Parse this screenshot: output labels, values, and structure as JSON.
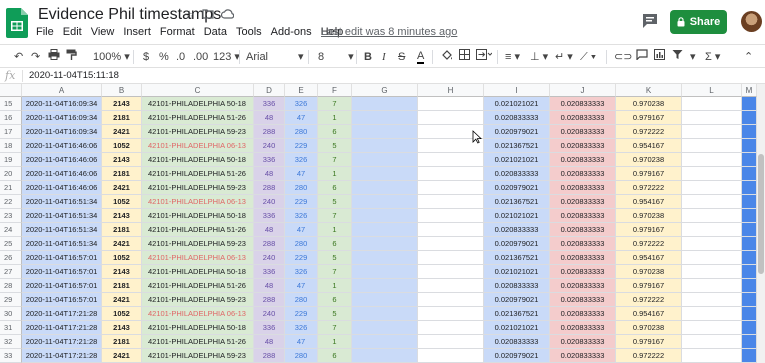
{
  "app": {
    "title": "Evidence Phil timestamps",
    "last_edit": "Last edit was 8 minutes ago",
    "share_label": "Share",
    "colors": {
      "share": "#1e8e3e",
      "sheets_green": "#0f9d58"
    }
  },
  "menu": [
    "File",
    "Edit",
    "View",
    "Insert",
    "Format",
    "Data",
    "Tools",
    "Add-ons",
    "Help"
  ],
  "toolbar": {
    "zoom": "100%",
    "currency": "$",
    "percent": "%",
    "decimal_decrease": ".0",
    "decimal_increase": ".00",
    "more_formats": "123",
    "font": "Arial",
    "font_size": "8",
    "bold": "B",
    "italic": "I",
    "strike": "S",
    "text_color": "A",
    "sigma": "Σ"
  },
  "formula_bar": {
    "fx": "fx",
    "value": "2020-11-04T15:11:18"
  },
  "columns": [
    "A",
    "B",
    "C",
    "D",
    "E",
    "F",
    "G",
    "H",
    "I",
    "J",
    "K",
    "L",
    "M"
  ],
  "rows": [
    {
      "n": "15",
      "a": "2020-11-04T16:09:34",
      "b": "2143",
      "c": "42101-PHILADELPHIA 50-18",
      "red": false,
      "d": "336",
      "e": "326",
      "f": "7",
      "i": "0.021021021",
      "j": "0.020833333",
      "k": "0.970238"
    },
    {
      "n": "16",
      "a": "2020-11-04T16:09:34",
      "b": "2181",
      "c": "42101-PHILADELPHIA 51-26",
      "red": false,
      "d": "48",
      "e": "47",
      "f": "1",
      "i": "0.020833333",
      "j": "0.020833333",
      "k": "0.979167"
    },
    {
      "n": "17",
      "a": "2020-11-04T16:09:34",
      "b": "2421",
      "c": "42101-PHILADELPHIA 59-23",
      "red": false,
      "d": "288",
      "e": "280",
      "f": "6",
      "i": "0.020979021",
      "j": "0.020833333",
      "k": "0.972222"
    },
    {
      "n": "18",
      "a": "2020-11-04T16:46:06",
      "b": "1052",
      "c": "42101-PHILADELPHIA 06-13",
      "red": true,
      "d": "240",
      "e": "229",
      "f": "5",
      "i": "0.021367521",
      "j": "0.020833333",
      "k": "0.954167"
    },
    {
      "n": "19",
      "a": "2020-11-04T16:46:06",
      "b": "2143",
      "c": "42101-PHILADELPHIA 50-18",
      "red": false,
      "d": "336",
      "e": "326",
      "f": "7",
      "i": "0.021021021",
      "j": "0.020833333",
      "k": "0.970238"
    },
    {
      "n": "20",
      "a": "2020-11-04T16:46:06",
      "b": "2181",
      "c": "42101-PHILADELPHIA 51-26",
      "red": false,
      "d": "48",
      "e": "47",
      "f": "1",
      "i": "0.020833333",
      "j": "0.020833333",
      "k": "0.979167"
    },
    {
      "n": "21",
      "a": "2020-11-04T16:46:06",
      "b": "2421",
      "c": "42101-PHILADELPHIA 59-23",
      "red": false,
      "d": "288",
      "e": "280",
      "f": "6",
      "i": "0.020979021",
      "j": "0.020833333",
      "k": "0.972222"
    },
    {
      "n": "22",
      "a": "2020-11-04T16:51:34",
      "b": "1052",
      "c": "42101-PHILADELPHIA 06-13",
      "red": true,
      "d": "240",
      "e": "229",
      "f": "5",
      "i": "0.021367521",
      "j": "0.020833333",
      "k": "0.954167"
    },
    {
      "n": "23",
      "a": "2020-11-04T16:51:34",
      "b": "2143",
      "c": "42101-PHILADELPHIA 50-18",
      "red": false,
      "d": "336",
      "e": "326",
      "f": "7",
      "i": "0.021021021",
      "j": "0.020833333",
      "k": "0.970238"
    },
    {
      "n": "24",
      "a": "2020-11-04T16:51:34",
      "b": "2181",
      "c": "42101-PHILADELPHIA 51-26",
      "red": false,
      "d": "48",
      "e": "47",
      "f": "1",
      "i": "0.020833333",
      "j": "0.020833333",
      "k": "0.979167"
    },
    {
      "n": "25",
      "a": "2020-11-04T16:51:34",
      "b": "2421",
      "c": "42101-PHILADELPHIA 59-23",
      "red": false,
      "d": "288",
      "e": "280",
      "f": "6",
      "i": "0.020979021",
      "j": "0.020833333",
      "k": "0.972222"
    },
    {
      "n": "26",
      "a": "2020-11-04T16:57:01",
      "b": "1052",
      "c": "42101-PHILADELPHIA 06-13",
      "red": true,
      "d": "240",
      "e": "229",
      "f": "5",
      "i": "0.021367521",
      "j": "0.020833333",
      "k": "0.954167"
    },
    {
      "n": "27",
      "a": "2020-11-04T16:57:01",
      "b": "2143",
      "c": "42101-PHILADELPHIA 50-18",
      "red": false,
      "d": "336",
      "e": "326",
      "f": "7",
      "i": "0.021021021",
      "j": "0.020833333",
      "k": "0.970238"
    },
    {
      "n": "28",
      "a": "2020-11-04T16:57:01",
      "b": "2181",
      "c": "42101-PHILADELPHIA 51-26",
      "red": false,
      "d": "48",
      "e": "47",
      "f": "1",
      "i": "0.020833333",
      "j": "0.020833333",
      "k": "0.979167"
    },
    {
      "n": "29",
      "a": "2020-11-04T16:57:01",
      "b": "2421",
      "c": "42101-PHILADELPHIA 59-23",
      "red": false,
      "d": "288",
      "e": "280",
      "f": "6",
      "i": "0.020979021",
      "j": "0.020833333",
      "k": "0.972222"
    },
    {
      "n": "30",
      "a": "2020-11-04T17:21:28",
      "b": "1052",
      "c": "42101-PHILADELPHIA 06-13",
      "red": true,
      "d": "240",
      "e": "229",
      "f": "5",
      "i": "0.021367521",
      "j": "0.020833333",
      "k": "0.954167"
    },
    {
      "n": "31",
      "a": "2020-11-04T17:21:28",
      "b": "2143",
      "c": "42101-PHILADELPHIA 50-18",
      "red": false,
      "d": "336",
      "e": "326",
      "f": "7",
      "i": "0.021021021",
      "j": "0.020833333",
      "k": "0.970238"
    },
    {
      "n": "32",
      "a": "2020-11-04T17:21:28",
      "b": "2181",
      "c": "42101-PHILADELPHIA 51-26",
      "red": false,
      "d": "48",
      "e": "47",
      "f": "1",
      "i": "0.020833333",
      "j": "0.020833333",
      "k": "0.979167"
    },
    {
      "n": "33",
      "a": "2020-11-04T17:21:28",
      "b": "2421",
      "c": "42101-PHILADELPHIA 59-23",
      "red": false,
      "d": "288",
      "e": "280",
      "f": "6",
      "i": "0.020979021",
      "j": "0.020833333",
      "k": "0.972222"
    }
  ]
}
